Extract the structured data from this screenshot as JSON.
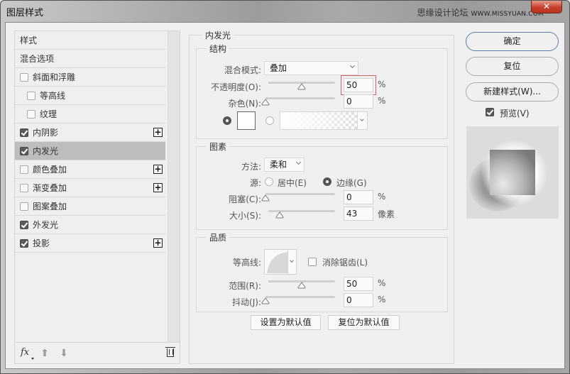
{
  "window": {
    "title": "图层样式",
    "watermark": "思缘设计论坛",
    "watermark_url": "WWW.MISSYUAN.COM",
    "close_glyph": "✕"
  },
  "sidebar": {
    "items": [
      {
        "label": "样式",
        "has_checkbox": false,
        "checked": false,
        "has_plus": false,
        "selected": false,
        "indent": false
      },
      {
        "label": "混合选项",
        "has_checkbox": false,
        "checked": false,
        "has_plus": false,
        "selected": false,
        "indent": false
      },
      {
        "label": "斜面和浮雕",
        "has_checkbox": true,
        "checked": false,
        "has_plus": false,
        "selected": false,
        "indent": false
      },
      {
        "label": "等高线",
        "has_checkbox": true,
        "checked": false,
        "has_plus": false,
        "selected": false,
        "indent": true
      },
      {
        "label": "纹理",
        "has_checkbox": true,
        "checked": false,
        "has_plus": false,
        "selected": false,
        "indent": true
      },
      {
        "label": "内阴影",
        "has_checkbox": true,
        "checked": true,
        "has_plus": true,
        "selected": false,
        "indent": false
      },
      {
        "label": "内发光",
        "has_checkbox": true,
        "checked": true,
        "has_plus": false,
        "selected": true,
        "indent": false
      },
      {
        "label": "颜色叠加",
        "has_checkbox": true,
        "checked": false,
        "has_plus": true,
        "selected": false,
        "indent": false
      },
      {
        "label": "渐变叠加",
        "has_checkbox": true,
        "checked": false,
        "has_plus": true,
        "selected": false,
        "indent": false
      },
      {
        "label": "图案叠加",
        "has_checkbox": true,
        "checked": false,
        "has_plus": false,
        "selected": false,
        "indent": false
      },
      {
        "label": "外发光",
        "has_checkbox": true,
        "checked": true,
        "has_plus": false,
        "selected": false,
        "indent": false
      },
      {
        "label": "投影",
        "has_checkbox": true,
        "checked": true,
        "has_plus": true,
        "selected": false,
        "indent": false
      }
    ],
    "footer": {
      "fx_label": "fx",
      "up_glyph": "⬆",
      "down_glyph": "⬇"
    }
  },
  "panel": {
    "title": "内发光",
    "structure": {
      "legend": "结构",
      "blend_mode_label": "混合模式:",
      "blend_mode_value": "叠加",
      "opacity_label": "不透明度(O):",
      "opacity_value": "50",
      "opacity_fraction": 0.5,
      "opacity_unit": "%",
      "noise_label": "杂色(N):",
      "noise_value": "0",
      "noise_fraction": 0,
      "noise_unit": "%",
      "color_mode": "solid",
      "color": "#ffffff"
    },
    "elements": {
      "legend": "图素",
      "method_label": "方法:",
      "method_value": "柔和",
      "source_label": "源:",
      "source_center_label": "居中(E)",
      "source_edge_label": "边缘(G)",
      "source_selected": "edge",
      "choke_label": "阻塞(C):",
      "choke_value": "0",
      "choke_fraction": 0,
      "choke_unit": "%",
      "size_label": "大小(S):",
      "size_value": "43",
      "size_fraction": 0.17,
      "size_unit": "像素"
    },
    "quality": {
      "legend": "品质",
      "contour_label": "等高线:",
      "antialias_label": "消除锯齿(L)",
      "antialias_checked": false,
      "range_label": "范围(R):",
      "range_value": "50",
      "range_fraction": 0.5,
      "range_unit": "%",
      "jitter_label": "抖动(J):",
      "jitter_value": "0",
      "jitter_fraction": 0,
      "jitter_unit": "%"
    },
    "make_default_label": "设置为默认值",
    "reset_default_label": "复位为默认值"
  },
  "actions": {
    "ok_label": "确定",
    "reset_label": "复位",
    "new_style_label": "新建样式(W)...",
    "preview_label": "预览(V)",
    "preview_checked": true
  }
}
